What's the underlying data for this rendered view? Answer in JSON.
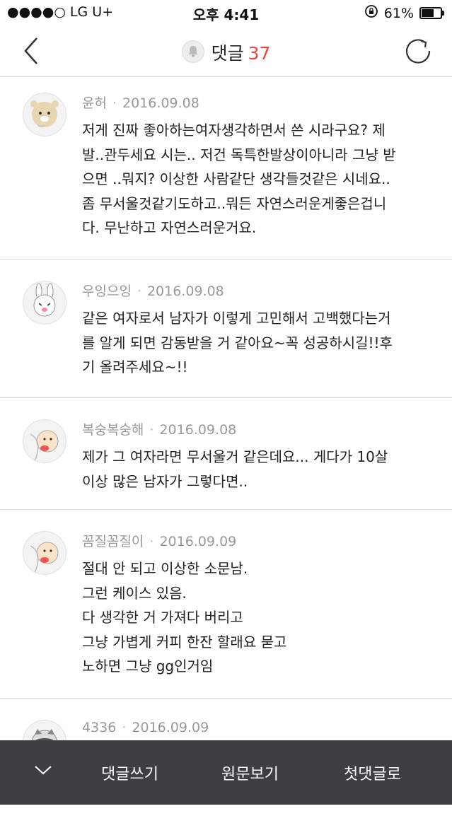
{
  "status": {
    "carrier": "●●●●○ LG U+",
    "time": "오후 4:41",
    "battery": "61%",
    "battery_level": 0.61
  },
  "nav": {
    "title": "댓글",
    "count": "37"
  },
  "comments": [
    {
      "author": "윤허",
      "date": "2016.09.08",
      "lines": [
        "저게 진짜 좋아하는여자생각하면서 쓴 시라구요? 제",
        "발..관두세요 시는.. 저건 독특한발상이아니라 그냥 받",
        "으면 ..뭐지?  이상한 사람같단 생각들것같은 시네요..",
        "좀 무서울것같기도하고..뭐든 자연스러운게좋은겁니",
        "다. 무난하고 자연스러운거요."
      ]
    },
    {
      "author": "우잉으잉",
      "date": "2016.09.08",
      "lines": [
        "같은 여자로서 남자가 이렇게 고민해서 고백했다는거",
        "를 알게 되면 감동받을 거 같아요~꼭 성공하시길!!후",
        "기 올려주세요~!!"
      ]
    },
    {
      "author": "복숭복숭해",
      "date": "2016.09.08",
      "lines": [
        "제가 그 여자라면 무서울거 같은데요... 게다가 10살",
        "이상 많은 남자가 그렇다면.."
      ]
    },
    {
      "author": "꼼질꼼질이",
      "date": "2016.09.09",
      "lines": [
        "절대 안 되고 이상한 소문남.",
        "그런 케이스 있음.",
        "다 생각한 거 가져다 버리고",
        "그냥 가볍게 커피 한잔 할래요 묻고",
        "노하면 그냥 gg인거임"
      ]
    },
    {
      "author": "4336",
      "date": "2016.09.09",
      "lines": []
    }
  ],
  "bottom_bar": {
    "write": "댓글쓰기",
    "original": "원문보기",
    "first": "첫댓글로"
  }
}
